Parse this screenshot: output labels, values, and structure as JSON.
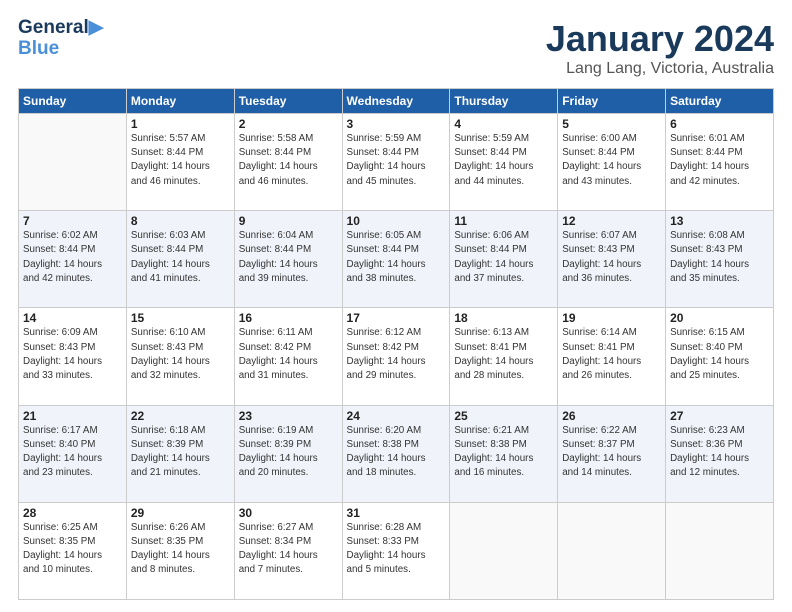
{
  "logo": {
    "line1": "General",
    "line2": "Blue"
  },
  "title": "January 2024",
  "subtitle": "Lang Lang, Victoria, Australia",
  "days_header": [
    "Sunday",
    "Monday",
    "Tuesday",
    "Wednesday",
    "Thursday",
    "Friday",
    "Saturday"
  ],
  "weeks": [
    [
      {
        "num": "",
        "info": ""
      },
      {
        "num": "1",
        "info": "Sunrise: 5:57 AM\nSunset: 8:44 PM\nDaylight: 14 hours\nand 46 minutes."
      },
      {
        "num": "2",
        "info": "Sunrise: 5:58 AM\nSunset: 8:44 PM\nDaylight: 14 hours\nand 46 minutes."
      },
      {
        "num": "3",
        "info": "Sunrise: 5:59 AM\nSunset: 8:44 PM\nDaylight: 14 hours\nand 45 minutes."
      },
      {
        "num": "4",
        "info": "Sunrise: 5:59 AM\nSunset: 8:44 PM\nDaylight: 14 hours\nand 44 minutes."
      },
      {
        "num": "5",
        "info": "Sunrise: 6:00 AM\nSunset: 8:44 PM\nDaylight: 14 hours\nand 43 minutes."
      },
      {
        "num": "6",
        "info": "Sunrise: 6:01 AM\nSunset: 8:44 PM\nDaylight: 14 hours\nand 42 minutes."
      }
    ],
    [
      {
        "num": "7",
        "info": "Sunrise: 6:02 AM\nSunset: 8:44 PM\nDaylight: 14 hours\nand 42 minutes."
      },
      {
        "num": "8",
        "info": "Sunrise: 6:03 AM\nSunset: 8:44 PM\nDaylight: 14 hours\nand 41 minutes."
      },
      {
        "num": "9",
        "info": "Sunrise: 6:04 AM\nSunset: 8:44 PM\nDaylight: 14 hours\nand 39 minutes."
      },
      {
        "num": "10",
        "info": "Sunrise: 6:05 AM\nSunset: 8:44 PM\nDaylight: 14 hours\nand 38 minutes."
      },
      {
        "num": "11",
        "info": "Sunrise: 6:06 AM\nSunset: 8:44 PM\nDaylight: 14 hours\nand 37 minutes."
      },
      {
        "num": "12",
        "info": "Sunrise: 6:07 AM\nSunset: 8:43 PM\nDaylight: 14 hours\nand 36 minutes."
      },
      {
        "num": "13",
        "info": "Sunrise: 6:08 AM\nSunset: 8:43 PM\nDaylight: 14 hours\nand 35 minutes."
      }
    ],
    [
      {
        "num": "14",
        "info": "Sunrise: 6:09 AM\nSunset: 8:43 PM\nDaylight: 14 hours\nand 33 minutes."
      },
      {
        "num": "15",
        "info": "Sunrise: 6:10 AM\nSunset: 8:43 PM\nDaylight: 14 hours\nand 32 minutes."
      },
      {
        "num": "16",
        "info": "Sunrise: 6:11 AM\nSunset: 8:42 PM\nDaylight: 14 hours\nand 31 minutes."
      },
      {
        "num": "17",
        "info": "Sunrise: 6:12 AM\nSunset: 8:42 PM\nDaylight: 14 hours\nand 29 minutes."
      },
      {
        "num": "18",
        "info": "Sunrise: 6:13 AM\nSunset: 8:41 PM\nDaylight: 14 hours\nand 28 minutes."
      },
      {
        "num": "19",
        "info": "Sunrise: 6:14 AM\nSunset: 8:41 PM\nDaylight: 14 hours\nand 26 minutes."
      },
      {
        "num": "20",
        "info": "Sunrise: 6:15 AM\nSunset: 8:40 PM\nDaylight: 14 hours\nand 25 minutes."
      }
    ],
    [
      {
        "num": "21",
        "info": "Sunrise: 6:17 AM\nSunset: 8:40 PM\nDaylight: 14 hours\nand 23 minutes."
      },
      {
        "num": "22",
        "info": "Sunrise: 6:18 AM\nSunset: 8:39 PM\nDaylight: 14 hours\nand 21 minutes."
      },
      {
        "num": "23",
        "info": "Sunrise: 6:19 AM\nSunset: 8:39 PM\nDaylight: 14 hours\nand 20 minutes."
      },
      {
        "num": "24",
        "info": "Sunrise: 6:20 AM\nSunset: 8:38 PM\nDaylight: 14 hours\nand 18 minutes."
      },
      {
        "num": "25",
        "info": "Sunrise: 6:21 AM\nSunset: 8:38 PM\nDaylight: 14 hours\nand 16 minutes."
      },
      {
        "num": "26",
        "info": "Sunrise: 6:22 AM\nSunset: 8:37 PM\nDaylight: 14 hours\nand 14 minutes."
      },
      {
        "num": "27",
        "info": "Sunrise: 6:23 AM\nSunset: 8:36 PM\nDaylight: 14 hours\nand 12 minutes."
      }
    ],
    [
      {
        "num": "28",
        "info": "Sunrise: 6:25 AM\nSunset: 8:35 PM\nDaylight: 14 hours\nand 10 minutes."
      },
      {
        "num": "29",
        "info": "Sunrise: 6:26 AM\nSunset: 8:35 PM\nDaylight: 14 hours\nand 8 minutes."
      },
      {
        "num": "30",
        "info": "Sunrise: 6:27 AM\nSunset: 8:34 PM\nDaylight: 14 hours\nand 7 minutes."
      },
      {
        "num": "31",
        "info": "Sunrise: 6:28 AM\nSunset: 8:33 PM\nDaylight: 14 hours\nand 5 minutes."
      },
      {
        "num": "",
        "info": ""
      },
      {
        "num": "",
        "info": ""
      },
      {
        "num": "",
        "info": ""
      }
    ]
  ]
}
